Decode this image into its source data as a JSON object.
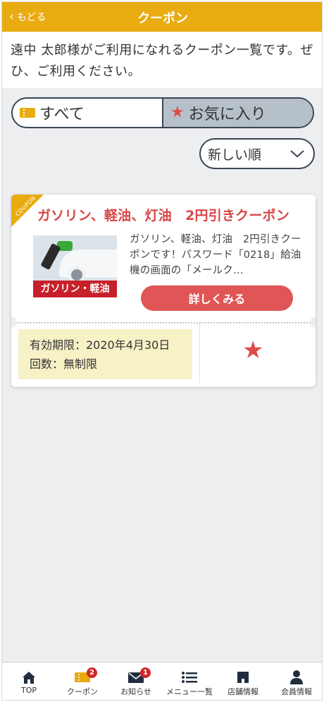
{
  "header": {
    "back_label": "もどる",
    "title": "クーポン"
  },
  "intro": {
    "text": "遠中 太郎様がご利用になれるクーポン一覧です。ぜひ、ご利用ください。"
  },
  "tabs": [
    {
      "label": "すべて",
      "icon": "ticket-icon",
      "selected": true
    },
    {
      "label": "お気に入り",
      "icon": "star-icon",
      "selected": false
    }
  ],
  "sort": {
    "selected": "新しい順"
  },
  "coupon": {
    "ribbon": "COUPON",
    "title": "ガソリン、軽油、灯油　2円引きクーポン",
    "image_caption": "ガソリン・軽油",
    "description": "ガソリン、軽油、灯油　2円引きクーポンです！パスワード「0218」給油機の画面の「メールク…",
    "detail_button": "詳しくみる",
    "validity": "有効期限：2020年4月30日",
    "count": "回数：無制限",
    "favorite": true
  },
  "colors": {
    "header": "#e8ac10",
    "accent_red": "#e05555",
    "validity_bg": "#f7f1c6"
  },
  "nav": {
    "items": [
      {
        "label": "TOP",
        "icon": "home-icon"
      },
      {
        "label": "クーポン",
        "icon": "coupon-icon",
        "badge": "2"
      },
      {
        "label": "お知らせ",
        "icon": "mail-icon",
        "badge": "1"
      },
      {
        "label": "メニュー一覧",
        "icon": "menu-list-icon"
      },
      {
        "label": "店舗情報",
        "icon": "store-icon"
      },
      {
        "label": "会員情報",
        "icon": "person-icon"
      }
    ]
  }
}
